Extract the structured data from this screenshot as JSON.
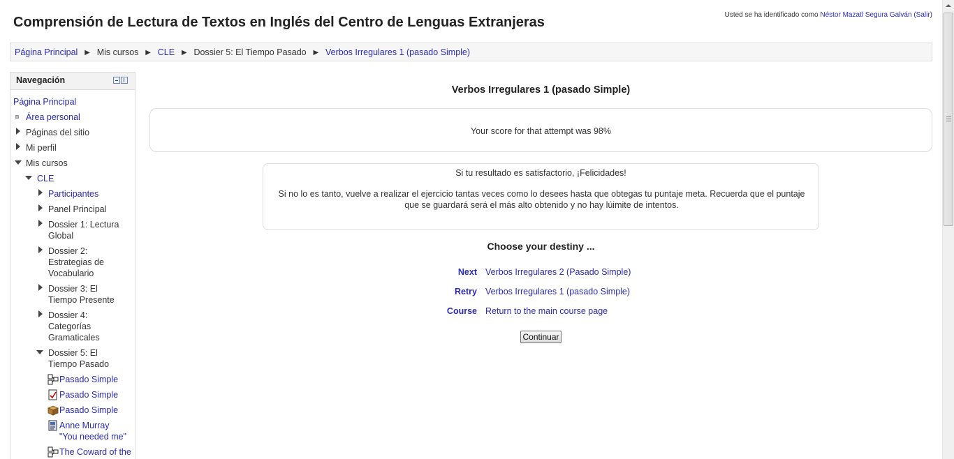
{
  "header": {
    "site_title": "Comprensión de Lectura de Textos en Inglés del Centro de Lenguas Extranjeras",
    "login_prefix": "Usted se ha identificado como",
    "user_name": "Néstor Mazatl Segura Galván",
    "logout_label": "(Salir)"
  },
  "breadcrumb": {
    "separator": "►",
    "items": [
      "Página Principal",
      "Mis cursos",
      "CLE",
      "Dossier 5: El Tiempo Pasado",
      "Verbos Irregulares 1 (pasado Simple)"
    ]
  },
  "navigation": {
    "title": "Navegación",
    "home": "Página Principal",
    "personal_area": "Área personal",
    "site_pages": "Páginas del sitio",
    "my_profile": "Mi perfil",
    "my_courses": "Mis cursos",
    "course": "CLE",
    "participants": "Participantes",
    "main_panel": "Panel Principal",
    "dossier1": [
      "Dossier 1: Lectura",
      "Global"
    ],
    "dossier2": [
      "Dossier 2:",
      "Estrategias de",
      "Vocabulario"
    ],
    "dossier3": [
      "Dossier 3: El",
      "Tiempo Presente"
    ],
    "dossier4": [
      "Dossier 4:",
      "Categorías",
      "Gramaticales"
    ],
    "dossier5": [
      "Dossier 5: El",
      "Tiempo Pasado"
    ],
    "activities": [
      {
        "label": "Pasado Simple",
        "icon": "lesson-icon"
      },
      {
        "label": "Pasado Simple",
        "icon": "quiz-icon"
      },
      {
        "label": "Pasado Simple",
        "icon": "package-icon"
      },
      {
        "label_lines": [
          "Anne Murray",
          "\"You needed me\""
        ],
        "icon": "page-icon"
      },
      {
        "label": "The Coward of the",
        "icon": "lesson-icon"
      }
    ]
  },
  "main": {
    "heading": "Verbos Irregulares 1 (pasado Simple)",
    "score_text": "Your score for that attempt was 98%",
    "feedback_line1": "Si tu resultado es satisfactorio, ¡Felicidades!",
    "feedback_line2": "Si no lo es tanto, vuelve a realizar el ejercicio tantas veces como lo desees hasta que obtegas tu puntaje meta. Recuerda que el puntaje que se guardará será el más alto obtenido y no hay lúimite de intentos.",
    "destiny_heading": "Choose your destiny ...",
    "destinations": [
      {
        "label": "Next",
        "link": "Verbos Irregulares 2 (Pasado Simple)"
      },
      {
        "label": "Retry",
        "link": "Verbos Irregulares 1 (pasado Simple)"
      },
      {
        "label": "Course",
        "link": "Return to the main course page"
      }
    ],
    "continue_label": "Continuar"
  },
  "colors": {
    "link": "#2b2bb0",
    "border": "#dddddd",
    "text": "#333333"
  }
}
